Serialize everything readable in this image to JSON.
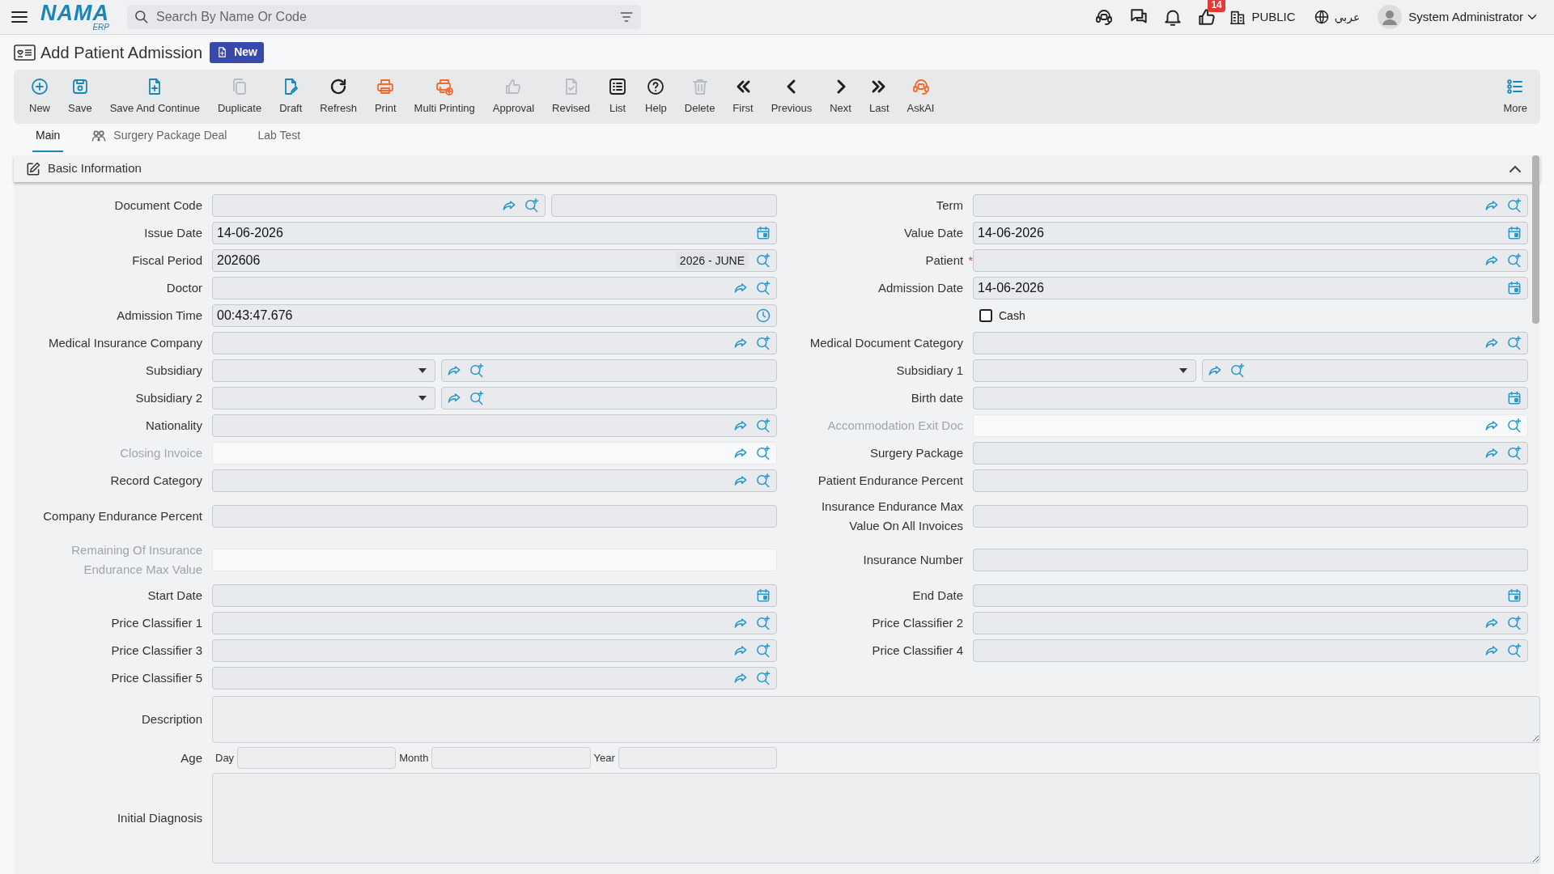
{
  "header": {
    "logo": "NAMA",
    "logo_sub": "ERP",
    "search": {
      "placeholder": "Search By Name Or Code"
    },
    "approvals_badge": "14",
    "branch": "PUBLIC",
    "language": "عربي",
    "user": "System Administrator"
  },
  "page": {
    "title": "Add Patient Admission",
    "status_badge": "New"
  },
  "toolbar": {
    "items": [
      {
        "label": "New",
        "color": "#1a86b5"
      },
      {
        "label": "Save",
        "color": "#1a86b5"
      },
      {
        "label": "Save And Continue",
        "color": "#1a86b5"
      },
      {
        "label": "Duplicate",
        "color": "#b9bcc0"
      },
      {
        "label": "Draft",
        "color": "#1a86b5"
      },
      {
        "label": "Refresh",
        "color": "#1f1f1f"
      },
      {
        "label": "Print",
        "color": "#f26a2e"
      },
      {
        "label": "Multi Printing",
        "color": "#f26a2e"
      },
      {
        "label": "Approval",
        "color": "#b9bcc0"
      },
      {
        "label": "Revised",
        "color": "#b9bcc0"
      },
      {
        "label": "List",
        "color": "#1f1f1f"
      },
      {
        "label": "Help",
        "color": "#1f1f1f"
      },
      {
        "label": "Delete",
        "color": "#b9bcc0"
      },
      {
        "label": "First",
        "color": "#1f1f1f"
      },
      {
        "label": "Previous",
        "color": "#1f1f1f"
      },
      {
        "label": "Next",
        "color": "#1f1f1f"
      },
      {
        "label": "Last",
        "color": "#1f1f1f"
      },
      {
        "label": "AskAI",
        "color": "#f26a2e"
      }
    ],
    "more": {
      "label": "More"
    }
  },
  "tabs": [
    {
      "label": "Main",
      "selected": true
    },
    {
      "label": "Surgery Package Deal",
      "selected": false
    },
    {
      "label": "Lab Test",
      "selected": false
    }
  ],
  "section": {
    "title": "Basic Information",
    "expanded": true
  },
  "form": {
    "left": [
      {
        "label": "Document Code",
        "kind": "code",
        "disabled": false
      },
      {
        "label": "Issue Date",
        "kind": "date",
        "value": "14-06-2026",
        "disabled": false
      },
      {
        "label": "Fiscal Period",
        "kind": "period",
        "value": "202606",
        "tag": "2026 - JUNE",
        "disabled": false
      },
      {
        "label": "Doctor",
        "kind": "lookup",
        "disabled": false
      },
      {
        "label": "Admission Time",
        "kind": "time",
        "value": "00:43:47.676",
        "disabled": false
      },
      {
        "label": "Medical Insurance Company",
        "kind": "lookup",
        "disabled": false
      },
      {
        "label": "Subsidiary",
        "kind": "dropdown_lookup",
        "disabled": false
      },
      {
        "label": "Subsidiary 2",
        "kind": "dropdown_lookup",
        "disabled": false
      },
      {
        "label": "Nationality",
        "kind": "lookup",
        "disabled": false
      },
      {
        "label": "Closing Invoice",
        "kind": "lookup",
        "disabled": true
      },
      {
        "label": "Record Category",
        "kind": "lookup",
        "disabled": false
      },
      {
        "label": "Company Endurance Percent",
        "kind": "text",
        "disabled": false
      },
      {
        "label": "Remaining Of Insurance Endurance Max Value",
        "kind": "text",
        "disabled": true
      },
      {
        "label": "Start Date",
        "kind": "date",
        "disabled": false
      },
      {
        "label": "Price Classifier 1",
        "kind": "lookup",
        "disabled": false
      },
      {
        "label": "Price Classifier 3",
        "kind": "lookup",
        "disabled": false
      },
      {
        "label": "Price Classifier 5",
        "kind": "lookup",
        "disabled": false
      }
    ],
    "right": [
      {
        "label": "Term",
        "kind": "lookup",
        "disabled": false
      },
      {
        "label": "Value Date",
        "kind": "date",
        "value": "14-06-2026",
        "disabled": false
      },
      {
        "label": "Patient",
        "kind": "lookup",
        "disabled": false,
        "required_mark": "*"
      },
      {
        "label": "Admission Date",
        "kind": "date",
        "value": "14-06-2026",
        "disabled": false
      },
      {
        "label": "Cash",
        "kind": "checkbox",
        "checked": false
      },
      {
        "label": "Medical Document Category",
        "kind": "lookup",
        "disabled": false
      },
      {
        "label": "Subsidiary 1",
        "kind": "dropdown_lookup",
        "disabled": false
      },
      {
        "label": "Birth date",
        "kind": "date",
        "disabled": false
      },
      {
        "label": "Accommodation Exit Doc",
        "kind": "lookup",
        "disabled": true
      },
      {
        "label": "Surgery Package",
        "kind": "lookup",
        "disabled": false
      },
      {
        "label": "Patient Endurance Percent",
        "kind": "text",
        "disabled": false
      },
      {
        "label": "Insurance Endurance Max Value On All Invoices",
        "kind": "text",
        "disabled": false
      },
      {
        "label": "Insurance Number",
        "kind": "text",
        "disabled": false
      },
      {
        "label": "End Date",
        "kind": "date",
        "disabled": false
      },
      {
        "label": "Price Classifier 2",
        "kind": "lookup",
        "disabled": false
      },
      {
        "label": "Price Classifier 4",
        "kind": "lookup",
        "disabled": false
      }
    ],
    "full": [
      {
        "label": "Description",
        "kind": "textarea"
      },
      {
        "label": "Age",
        "kind": "age",
        "parts": [
          "Day",
          "Month",
          "Year"
        ]
      },
      {
        "label": "Initial Diagnosis",
        "kind": "large_textarea"
      }
    ]
  }
}
